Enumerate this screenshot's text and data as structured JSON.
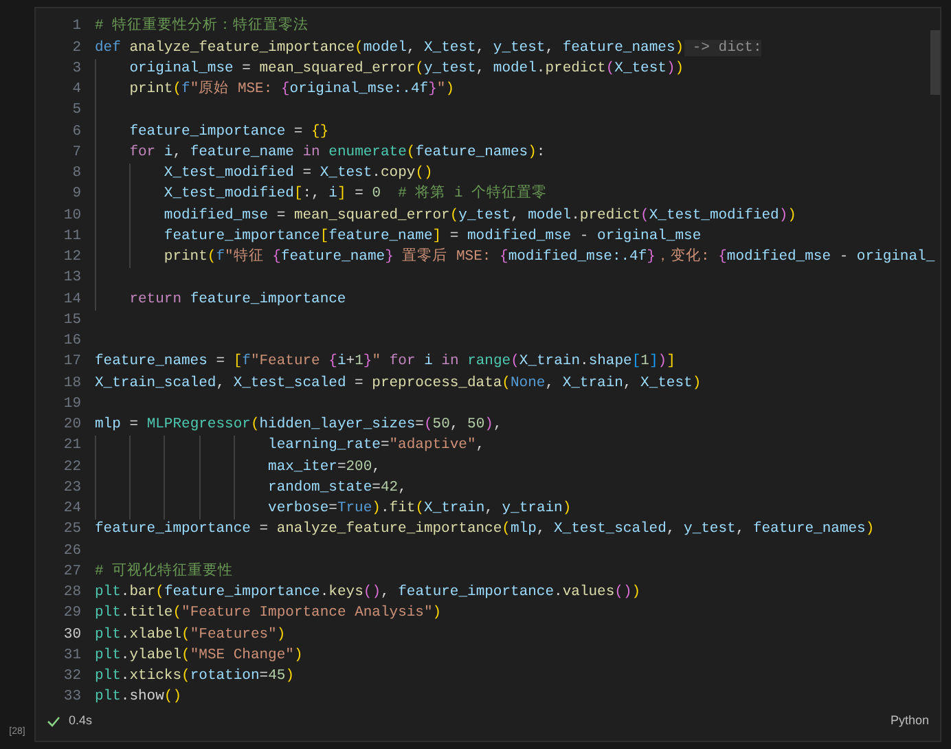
{
  "cell": {
    "execution_count": "[28]",
    "status": {
      "succeeded": true,
      "duration": "0.4s"
    },
    "language": "Python",
    "lines": [
      {
        "number": "1",
        "current": false,
        "tokens": [
          {
            "kind": "comment",
            "text": "# 特征重要性分析：特征置零法"
          }
        ]
      },
      {
        "number": "2",
        "current": false,
        "tokens": [
          {
            "kind": "keyword",
            "text": "def"
          },
          {
            "kind": "function",
            "text": " analyze_feature_importance"
          },
          {
            "kind": "bracket1",
            "text": "("
          },
          {
            "kind": "variable",
            "text": "model"
          },
          {
            "kind": "plain",
            "text": ", "
          },
          {
            "kind": "variable",
            "text": "X_test"
          },
          {
            "kind": "plain",
            "text": ", "
          },
          {
            "kind": "variable",
            "text": "y_test"
          },
          {
            "kind": "plain",
            "text": ", "
          },
          {
            "kind": "variable",
            "text": "feature_names"
          },
          {
            "kind": "bracket1",
            "text": ")"
          },
          {
            "kind": "hint",
            "text": " -> dict:"
          }
        ]
      },
      {
        "number": "3",
        "current": false,
        "tokens": [
          {
            "kind": "variable",
            "text": "    original_mse"
          },
          {
            "kind": "plain",
            "text": " = "
          },
          {
            "kind": "function",
            "text": "mean_squared_error"
          },
          {
            "kind": "bracket1",
            "text": "("
          },
          {
            "kind": "variable",
            "text": "y_test"
          },
          {
            "kind": "plain",
            "text": ", "
          },
          {
            "kind": "variable",
            "text": "model"
          },
          {
            "kind": "plain",
            "text": "."
          },
          {
            "kind": "function",
            "text": "predict"
          },
          {
            "kind": "bracket2",
            "text": "("
          },
          {
            "kind": "variable",
            "text": "X_test"
          },
          {
            "kind": "bracket2",
            "text": ")"
          },
          {
            "kind": "bracket1",
            "text": ")"
          }
        ]
      },
      {
        "number": "4",
        "current": false,
        "tokens": [
          {
            "kind": "function",
            "text": "    print"
          },
          {
            "kind": "bracket1",
            "text": "("
          },
          {
            "kind": "keyword",
            "text": "f"
          },
          {
            "kind": "string",
            "text": "\"原始 MSE: "
          },
          {
            "kind": "bracket2",
            "text": "{"
          },
          {
            "kind": "variable",
            "text": "original_mse:.4f"
          },
          {
            "kind": "bracket2",
            "text": "}"
          },
          {
            "kind": "string",
            "text": "\""
          },
          {
            "kind": "bracket1",
            "text": ")"
          }
        ]
      },
      {
        "number": "5",
        "current": false
      },
      {
        "number": "6",
        "current": false,
        "tokens": [
          {
            "kind": "variable",
            "text": "    feature_importance"
          },
          {
            "kind": "plain",
            "text": " = "
          },
          {
            "kind": "bracket1",
            "text": "{}"
          }
        ]
      },
      {
        "number": "7",
        "current": false,
        "tokens": [
          {
            "kind": "control",
            "text": "    for"
          },
          {
            "kind": "variable",
            "text": " i"
          },
          {
            "kind": "plain",
            "text": ", "
          },
          {
            "kind": "variable",
            "text": "feature_name"
          },
          {
            "kind": "control",
            "text": " in"
          },
          {
            "kind": "builtin",
            "text": " enumerate"
          },
          {
            "kind": "bracket1",
            "text": "("
          },
          {
            "kind": "variable",
            "text": "feature_names"
          },
          {
            "kind": "bracket1",
            "text": ")"
          },
          {
            "kind": "plain",
            "text": ":"
          }
        ]
      },
      {
        "number": "8",
        "current": false,
        "tokens": [
          {
            "kind": "variable",
            "text": "        X_test_modified"
          },
          {
            "kind": "plain",
            "text": " = "
          },
          {
            "kind": "variable",
            "text": "X_test"
          },
          {
            "kind": "plain",
            "text": "."
          },
          {
            "kind": "function",
            "text": "copy"
          },
          {
            "kind": "bracket1",
            "text": "()"
          }
        ]
      },
      {
        "number": "9",
        "current": false,
        "tokens": [
          {
            "kind": "variable",
            "text": "        X_test_modified"
          },
          {
            "kind": "bracket1",
            "text": "["
          },
          {
            "kind": "plain",
            "text": ":, "
          },
          {
            "kind": "variable",
            "text": "i"
          },
          {
            "kind": "bracket1",
            "text": "]"
          },
          {
            "kind": "plain",
            "text": " = "
          },
          {
            "kind": "number",
            "text": "0"
          },
          {
            "kind": "comment",
            "text": "  # 将第 i 个特征置零"
          }
        ]
      },
      {
        "number": "10",
        "current": false,
        "tokens": [
          {
            "kind": "variable",
            "text": "        modified_mse"
          },
          {
            "kind": "plain",
            "text": " = "
          },
          {
            "kind": "function",
            "text": "mean_squared_error"
          },
          {
            "kind": "bracket1",
            "text": "("
          },
          {
            "kind": "variable",
            "text": "y_test"
          },
          {
            "kind": "plain",
            "text": ", "
          },
          {
            "kind": "variable",
            "text": "model"
          },
          {
            "kind": "plain",
            "text": "."
          },
          {
            "kind": "function",
            "text": "predict"
          },
          {
            "kind": "bracket2",
            "text": "("
          },
          {
            "kind": "variable",
            "text": "X_test_modified"
          },
          {
            "kind": "bracket2",
            "text": ")"
          },
          {
            "kind": "bracket1",
            "text": ")"
          }
        ]
      },
      {
        "number": "11",
        "current": false,
        "tokens": [
          {
            "kind": "variable",
            "text": "        feature_importance"
          },
          {
            "kind": "bracket1",
            "text": "["
          },
          {
            "kind": "variable",
            "text": "feature_name"
          },
          {
            "kind": "bracket1",
            "text": "]"
          },
          {
            "kind": "plain",
            "text": " = "
          },
          {
            "kind": "variable",
            "text": "modified_mse"
          },
          {
            "kind": "plain",
            "text": " - "
          },
          {
            "kind": "variable",
            "text": "original_mse"
          }
        ]
      },
      {
        "number": "12",
        "current": false,
        "tokens": [
          {
            "kind": "function",
            "text": "        print"
          },
          {
            "kind": "bracket1",
            "text": "("
          },
          {
            "kind": "keyword",
            "text": "f"
          },
          {
            "kind": "string",
            "text": "\"特征 "
          },
          {
            "kind": "bracket2",
            "text": "{"
          },
          {
            "kind": "variable",
            "text": "feature_name"
          },
          {
            "kind": "bracket2",
            "text": "}"
          },
          {
            "kind": "string",
            "text": " 置零后 MSE: "
          },
          {
            "kind": "bracket2",
            "text": "{"
          },
          {
            "kind": "variable",
            "text": "modified_mse:.4f"
          },
          {
            "kind": "bracket2",
            "text": "}"
          },
          {
            "kind": "string",
            "text": "，变化: "
          },
          {
            "kind": "bracket2",
            "text": "{"
          },
          {
            "kind": "variable",
            "text": "modified_mse"
          },
          {
            "kind": "plain",
            "text": " - "
          },
          {
            "kind": "variable",
            "text": "original_"
          }
        ]
      },
      {
        "number": "13",
        "current": false
      },
      {
        "number": "14",
        "current": false,
        "tokens": [
          {
            "kind": "control",
            "text": "    return"
          },
          {
            "kind": "variable",
            "text": " feature_importance"
          }
        ]
      },
      {
        "number": "15",
        "current": false
      },
      {
        "number": "16",
        "current": false
      },
      {
        "number": "17",
        "current": false,
        "tokens": [
          {
            "kind": "variable",
            "text": "feature_names"
          },
          {
            "kind": "plain",
            "text": " = "
          },
          {
            "kind": "bracket1",
            "text": "["
          },
          {
            "kind": "keyword",
            "text": "f"
          },
          {
            "kind": "string",
            "text": "\"Feature "
          },
          {
            "kind": "bracket2",
            "text": "{"
          },
          {
            "kind": "variable",
            "text": "i"
          },
          {
            "kind": "plain",
            "text": "+"
          },
          {
            "kind": "number",
            "text": "1"
          },
          {
            "kind": "bracket2",
            "text": "}"
          },
          {
            "kind": "string",
            "text": "\""
          },
          {
            "kind": "control",
            "text": " for"
          },
          {
            "kind": "variable",
            "text": " i"
          },
          {
            "kind": "control",
            "text": " in"
          },
          {
            "kind": "builtin",
            "text": " range"
          },
          {
            "kind": "bracket2",
            "text": "("
          },
          {
            "kind": "variable",
            "text": "X_train"
          },
          {
            "kind": "plain",
            "text": "."
          },
          {
            "kind": "variable",
            "text": "shape"
          },
          {
            "kind": "bracket3",
            "text": "["
          },
          {
            "kind": "number",
            "text": "1"
          },
          {
            "kind": "bracket3",
            "text": "]"
          },
          {
            "kind": "bracket2",
            "text": ")"
          },
          {
            "kind": "bracket1",
            "text": "]"
          }
        ]
      },
      {
        "number": "18",
        "current": false,
        "tokens": [
          {
            "kind": "variable",
            "text": "X_train_scaled"
          },
          {
            "kind": "plain",
            "text": ", "
          },
          {
            "kind": "variable",
            "text": "X_test_scaled"
          },
          {
            "kind": "plain",
            "text": " = "
          },
          {
            "kind": "function",
            "text": "preprocess_data"
          },
          {
            "kind": "bracket1",
            "text": "("
          },
          {
            "kind": "keyword",
            "text": "None"
          },
          {
            "kind": "plain",
            "text": ", "
          },
          {
            "kind": "variable",
            "text": "X_train"
          },
          {
            "kind": "plain",
            "text": ", "
          },
          {
            "kind": "variable",
            "text": "X_test"
          },
          {
            "kind": "bracket1",
            "text": ")"
          }
        ]
      },
      {
        "number": "19",
        "current": false
      },
      {
        "number": "20",
        "current": false,
        "tokens": [
          {
            "kind": "variable",
            "text": "mlp"
          },
          {
            "kind": "plain",
            "text": " = "
          },
          {
            "kind": "builtin",
            "text": "MLPRegressor"
          },
          {
            "kind": "bracket1",
            "text": "("
          },
          {
            "kind": "variable",
            "text": "hidden_layer_sizes"
          },
          {
            "kind": "plain",
            "text": "="
          },
          {
            "kind": "bracket2",
            "text": "("
          },
          {
            "kind": "number",
            "text": "50"
          },
          {
            "kind": "plain",
            "text": ", "
          },
          {
            "kind": "number",
            "text": "50"
          },
          {
            "kind": "bracket2",
            "text": ")"
          },
          {
            "kind": "plain",
            "text": ","
          }
        ]
      },
      {
        "number": "21",
        "current": false,
        "tokens": [
          {
            "kind": "variable",
            "text": "                    learning_rate"
          },
          {
            "kind": "plain",
            "text": "="
          },
          {
            "kind": "string",
            "text": "\"adaptive\""
          },
          {
            "kind": "plain",
            "text": ","
          }
        ]
      },
      {
        "number": "22",
        "current": false,
        "tokens": [
          {
            "kind": "variable",
            "text": "                    max_iter"
          },
          {
            "kind": "plain",
            "text": "="
          },
          {
            "kind": "number",
            "text": "200"
          },
          {
            "kind": "plain",
            "text": ","
          }
        ]
      },
      {
        "number": "23",
        "current": false,
        "tokens": [
          {
            "kind": "variable",
            "text": "                    random_state"
          },
          {
            "kind": "plain",
            "text": "="
          },
          {
            "kind": "number",
            "text": "42"
          },
          {
            "kind": "plain",
            "text": ","
          }
        ]
      },
      {
        "number": "24",
        "current": false,
        "tokens": [
          {
            "kind": "variable",
            "text": "                    verbose"
          },
          {
            "kind": "plain",
            "text": "="
          },
          {
            "kind": "keyword",
            "text": "True"
          },
          {
            "kind": "bracket1",
            "text": ")"
          },
          {
            "kind": "plain",
            "text": "."
          },
          {
            "kind": "function",
            "text": "fit"
          },
          {
            "kind": "bracket1",
            "text": "("
          },
          {
            "kind": "variable",
            "text": "X_train"
          },
          {
            "kind": "plain",
            "text": ", "
          },
          {
            "kind": "variable",
            "text": "y_train"
          },
          {
            "kind": "bracket1",
            "text": ")"
          }
        ]
      },
      {
        "number": "25",
        "current": false,
        "tokens": [
          {
            "kind": "variable",
            "text": "feature_importance"
          },
          {
            "kind": "plain",
            "text": " = "
          },
          {
            "kind": "function",
            "text": "analyze_feature_importance"
          },
          {
            "kind": "bracket1",
            "text": "("
          },
          {
            "kind": "variable",
            "text": "mlp"
          },
          {
            "kind": "plain",
            "text": ", "
          },
          {
            "kind": "variable",
            "text": "X_test_scaled"
          },
          {
            "kind": "plain",
            "text": ", "
          },
          {
            "kind": "variable",
            "text": "y_test"
          },
          {
            "kind": "plain",
            "text": ", "
          },
          {
            "kind": "variable",
            "text": "feature_names"
          },
          {
            "kind": "bracket1",
            "text": ")"
          }
        ]
      },
      {
        "number": "26",
        "current": false
      },
      {
        "number": "27",
        "current": false,
        "tokens": [
          {
            "kind": "comment",
            "text": "# 可视化特征重要性"
          }
        ]
      },
      {
        "number": "28",
        "current": false,
        "tokens": [
          {
            "kind": "module",
            "text": "plt"
          },
          {
            "kind": "plain",
            "text": "."
          },
          {
            "kind": "function",
            "text": "bar"
          },
          {
            "kind": "bracket1",
            "text": "("
          },
          {
            "kind": "variable",
            "text": "feature_importance"
          },
          {
            "kind": "plain",
            "text": "."
          },
          {
            "kind": "function",
            "text": "keys"
          },
          {
            "kind": "bracket2",
            "text": "()"
          },
          {
            "kind": "plain",
            "text": ", "
          },
          {
            "kind": "variable",
            "text": "feature_importance"
          },
          {
            "kind": "plain",
            "text": "."
          },
          {
            "kind": "function",
            "text": "values"
          },
          {
            "kind": "bracket2",
            "text": "()"
          },
          {
            "kind": "bracket1",
            "text": ")"
          }
        ]
      },
      {
        "number": "29",
        "current": false,
        "tokens": [
          {
            "kind": "module",
            "text": "plt"
          },
          {
            "kind": "plain",
            "text": "."
          },
          {
            "kind": "function",
            "text": "title"
          },
          {
            "kind": "bracket1",
            "text": "("
          },
          {
            "kind": "string",
            "text": "\"Feature Importance Analysis\""
          },
          {
            "kind": "bracket1",
            "text": ")"
          }
        ]
      },
      {
        "number": "30",
        "current": true,
        "tokens": [
          {
            "kind": "module",
            "text": "plt"
          },
          {
            "kind": "plain",
            "text": "."
          },
          {
            "kind": "function",
            "text": "xlabel"
          },
          {
            "kind": "bracket1",
            "text": "("
          },
          {
            "kind": "string",
            "text": "\"Features\""
          },
          {
            "kind": "bracket1",
            "text": ")"
          }
        ]
      },
      {
        "number": "31",
        "current": false,
        "tokens": [
          {
            "kind": "module",
            "text": "plt"
          },
          {
            "kind": "plain",
            "text": "."
          },
          {
            "kind": "function",
            "text": "ylabel"
          },
          {
            "kind": "bracket1",
            "text": "("
          },
          {
            "kind": "string",
            "text": "\"MSE Change\""
          },
          {
            "kind": "bracket1",
            "text": ")"
          }
        ]
      },
      {
        "number": "32",
        "current": false,
        "tokens": [
          {
            "kind": "module",
            "text": "plt"
          },
          {
            "kind": "plain",
            "text": "."
          },
          {
            "kind": "function",
            "text": "xticks"
          },
          {
            "kind": "bracket1",
            "text": "("
          },
          {
            "kind": "variable",
            "text": "rotation"
          },
          {
            "kind": "plain",
            "text": "="
          },
          {
            "kind": "number",
            "text": "45"
          },
          {
            "kind": "bracket1",
            "text": ")"
          }
        ]
      },
      {
        "number": "33",
        "current": false,
        "tokens": [
          {
            "kind": "module",
            "text": "plt"
          },
          {
            "kind": "plain",
            "text": ".show"
          },
          {
            "kind": "bracket1",
            "text": "()"
          }
        ]
      }
    ]
  }
}
